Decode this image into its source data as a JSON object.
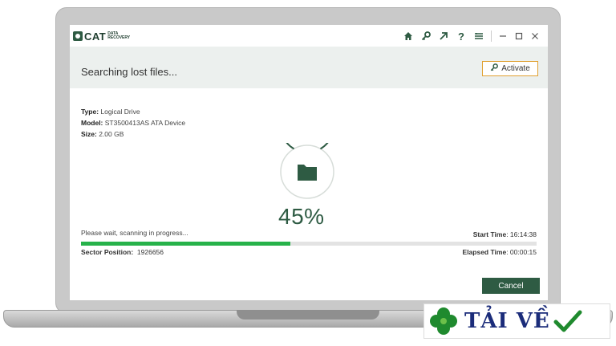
{
  "app": {
    "logo_text": "CAT",
    "logo_sub_1": "DATA",
    "logo_sub_2": "RECOVERY",
    "toolbar_icons": [
      "home-icon",
      "key-icon",
      "arrow-icon",
      "help-icon",
      "menu-icon"
    ],
    "window_controls": [
      "minimize-icon",
      "maximize-icon",
      "close-icon"
    ]
  },
  "header": {
    "title": "Searching lost files...",
    "activate_label": "Activate"
  },
  "drive": {
    "type_label": "Type:",
    "type_value": "Logical Drive",
    "model_label": "Model:",
    "model_value": "ST3500413AS ATA Device",
    "size_label": "Size:",
    "size_value": "2.00 GB"
  },
  "scan": {
    "percent_text": "45%",
    "progress": 0.46,
    "status_text": "Please wait, scanning in progress...",
    "start_label": "Start Time",
    "start_value": ": 16:14:38",
    "sector_label": "Sector Position:",
    "sector_value": "1926656",
    "elapsed_label": "Elapsed Time",
    "elapsed_value": ": 00:00:15"
  },
  "actions": {
    "cancel_label": "Cancel"
  },
  "watermark": {
    "text": "TẢI VỀ"
  },
  "colors": {
    "brand_green": "#2e5b43",
    "progress_green": "#27b24a",
    "activate_border": "#e0a030"
  }
}
